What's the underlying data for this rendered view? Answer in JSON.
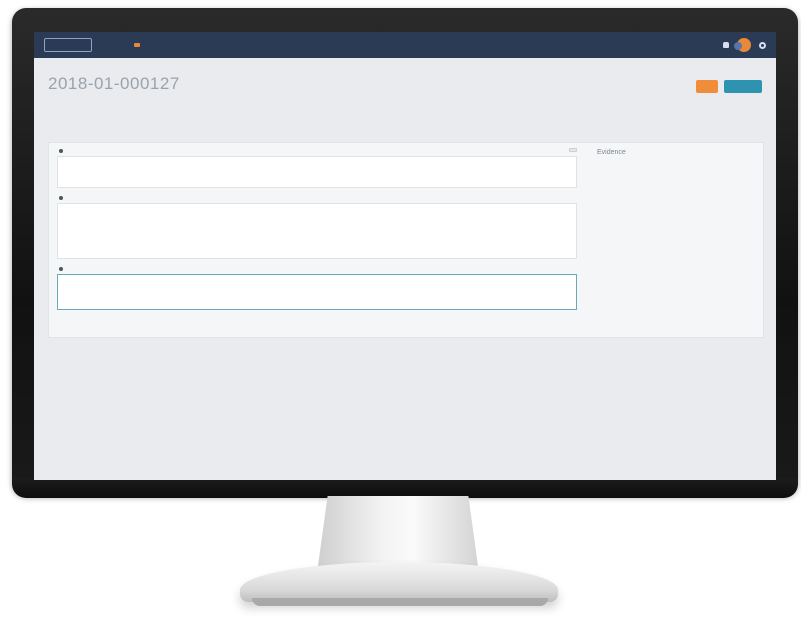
{
  "app": {
    "logo": "",
    "nav": [
      "",
      "",
      "",
      "",
      ""
    ],
    "active_nav_index": 1,
    "user_name": ""
  },
  "case": {
    "number": "2018-01-000127",
    "status_label": "",
    "status_value": ""
  },
  "actions": {
    "primary": "",
    "secondary": ""
  },
  "tabs": [
    "",
    "",
    "",
    ""
  ],
  "active_tab_index": 3,
  "fields": [
    {
      "label": "",
      "value": "",
      "copy_label": ""
    },
    {
      "label": "",
      "value": ""
    },
    {
      "label": "",
      "value": ""
    }
  ],
  "evidence": {
    "title": "Evidence",
    "file_name": "",
    "file_meta": ""
  },
  "colors": {
    "topbar": "#2b3a55",
    "accent": "#e8893a",
    "teal": "#2e93b0"
  }
}
